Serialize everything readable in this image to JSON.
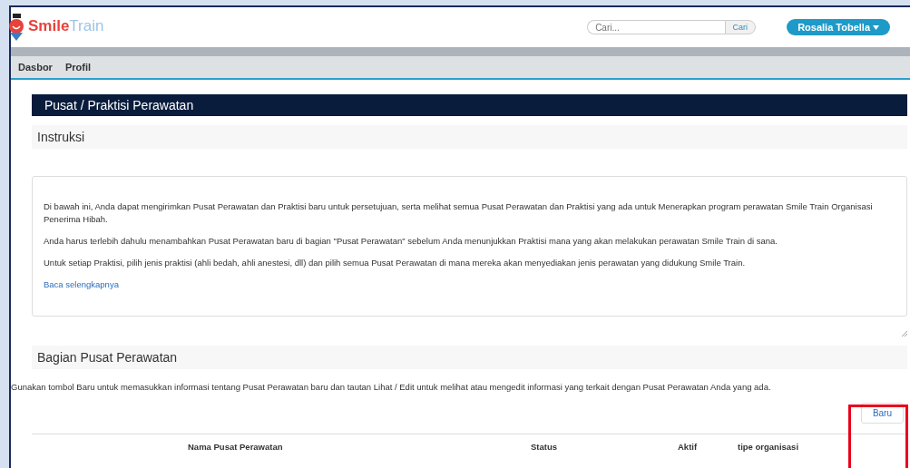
{
  "header": {
    "logo": {
      "first": "Smile",
      "second": "Train"
    },
    "search": {
      "placeholder": "Cari...",
      "button": "Cari"
    },
    "user_menu": "Rosalia Tobella"
  },
  "nav": [
    {
      "label": "Dasbor"
    },
    {
      "label": "Profil"
    }
  ],
  "page_title": "Pusat / Praktisi Perawatan",
  "instructions": {
    "heading": "Instruksi",
    "paragraphs": [
      "Di bawah ini, Anda dapat mengirimkan Pusat Perawatan dan Praktisi baru untuk persetujuan, serta melihat semua Pusat Perawatan dan Praktisi yang ada untuk Menerapkan program perawatan Smile Train Organisasi Penerima Hibah.",
      "Anda harus terlebih dahulu menambahkan Pusat Perawatan baru di bagian \"Pusat Perawatan\" sebelum Anda menunjukkan Praktisi mana yang akan melakukan perawatan Smile Train di sana.",
      "Untuk setiap Praktisi, pilih jenis praktisi (ahli bedah, ahli anestesi, dll) dan pilih semua Pusat Perawatan di mana mereka akan menyediakan jenis perawatan yang didukung Smile Train."
    ],
    "read_more": "Baca selengkapnya"
  },
  "section": {
    "heading": "Bagian Pusat Perawatan",
    "description": "Gunakan tombol Baru untuk memasukkan informasi tentang Pusat Perawatan baru dan tautan Lihat / Edit untuk melihat atau mengedit informasi yang terkait dengan Pusat Perawatan Anda yang ada.",
    "new_button": "Baru",
    "table": {
      "columns": [
        "Nama Pusat Perawatan",
        "Status",
        "Aktif",
        "tipe organisasi"
      ]
    }
  }
}
